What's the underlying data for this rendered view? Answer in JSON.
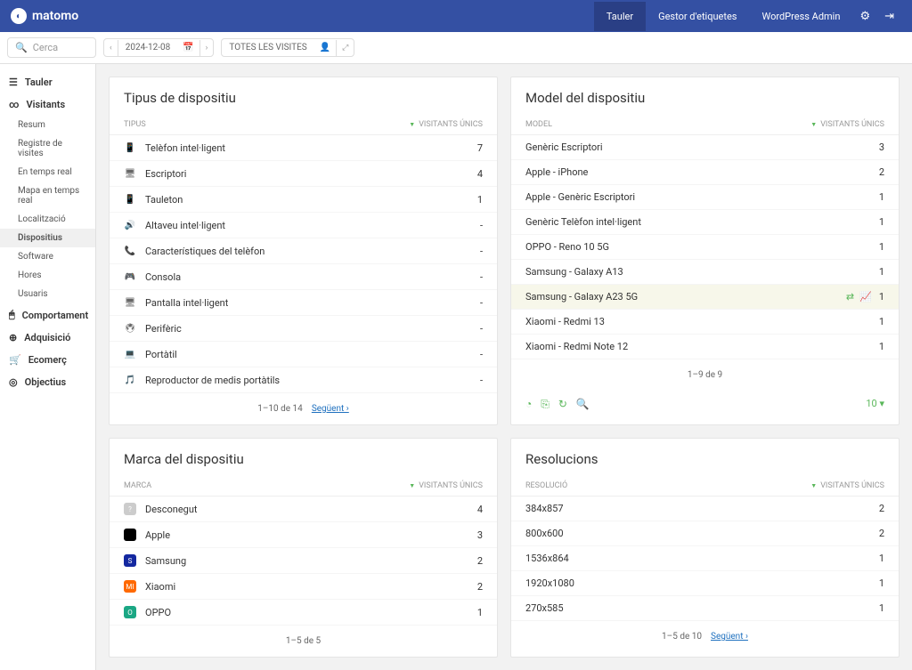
{
  "brand": "matomo",
  "topnav": {
    "tauler": "Tauler",
    "gestor": "Gestor d'etiquetes",
    "wp": "WordPress Admin"
  },
  "search_placeholder": "Cerca",
  "date": "2024-12-08",
  "segment": "TOTES LES VISITES",
  "sidebar": {
    "tauler": "Tauler",
    "visitants": "Visitants",
    "resum": "Resum",
    "registre": "Registre de visites",
    "temps_real": "En temps real",
    "mapa": "Mapa en temps real",
    "local": "Localització",
    "dispositius": "Dispositius",
    "software": "Software",
    "hores": "Hores",
    "usuaris": "Usuaris",
    "comportament": "Comportament",
    "adquisicio": "Adquisició",
    "ecomerc": "Ecomerç",
    "objectius": "Objectius"
  },
  "cards": {
    "tipus": {
      "title": "Tipus de dispositiu",
      "dim": "TIPUS",
      "metric": "VISITANTS ÚNICS",
      "rows": [
        {
          "label": "Telèfon intel·ligent",
          "val": "7"
        },
        {
          "label": "Escriptori",
          "val": "4"
        },
        {
          "label": "Tauleton",
          "val": "1"
        },
        {
          "label": "Altaveu intel·ligent",
          "val": "-"
        },
        {
          "label": "Característiques del telèfon",
          "val": "-"
        },
        {
          "label": "Consola",
          "val": "-"
        },
        {
          "label": "Pantalla intel·ligent",
          "val": "-"
        },
        {
          "label": "Perifèric",
          "val": "-"
        },
        {
          "label": "Portàtil",
          "val": "-"
        },
        {
          "label": "Reproductor de medis portàtils",
          "val": "-"
        }
      ],
      "pager": "1–10 de 14",
      "next": "Següent ›"
    },
    "model": {
      "title": "Model del dispositiu",
      "dim": "MODEL",
      "metric": "VISITANTS ÚNICS",
      "rows": [
        {
          "label": "Genèric Escriptori",
          "val": "3"
        },
        {
          "label": "Apple - iPhone",
          "val": "2"
        },
        {
          "label": "Apple - Genèric Escriptori",
          "val": "1"
        },
        {
          "label": "Genèric Telèfon intel·ligent",
          "val": "1"
        },
        {
          "label": "OPPO - Reno 10 5G",
          "val": "1"
        },
        {
          "label": "Samsung - Galaxy A13",
          "val": "1"
        },
        {
          "label": "Samsung - Galaxy A23 5G",
          "val": "1"
        },
        {
          "label": "Xiaomi - Redmi 13",
          "val": "1"
        },
        {
          "label": "Xiaomi - Redmi Note 12",
          "val": "1"
        }
      ],
      "pager": "1–9 de 9",
      "limit": "10 ▾"
    },
    "marca": {
      "title": "Marca del dispositiu",
      "dim": "MARCA",
      "metric": "VISITANTS ÚNICS",
      "rows": [
        {
          "label": "Desconegut",
          "val": "4"
        },
        {
          "label": "Apple",
          "val": "3"
        },
        {
          "label": "Samsung",
          "val": "2"
        },
        {
          "label": "Xiaomi",
          "val": "2"
        },
        {
          "label": "OPPO",
          "val": "1"
        }
      ],
      "pager": "1–5 de 5"
    },
    "resolucions": {
      "title": "Resolucions",
      "dim": "RESOLUCIÓ",
      "metric": "VISITANTS ÚNICS",
      "rows": [
        {
          "label": "384x857",
          "val": "2"
        },
        {
          "label": "800x600",
          "val": "2"
        },
        {
          "label": "1536x864",
          "val": "1"
        },
        {
          "label": "1920x1080",
          "val": "1"
        },
        {
          "label": "270x585",
          "val": "1"
        }
      ],
      "pager": "1–5 de 10",
      "next": "Següent ›"
    }
  }
}
